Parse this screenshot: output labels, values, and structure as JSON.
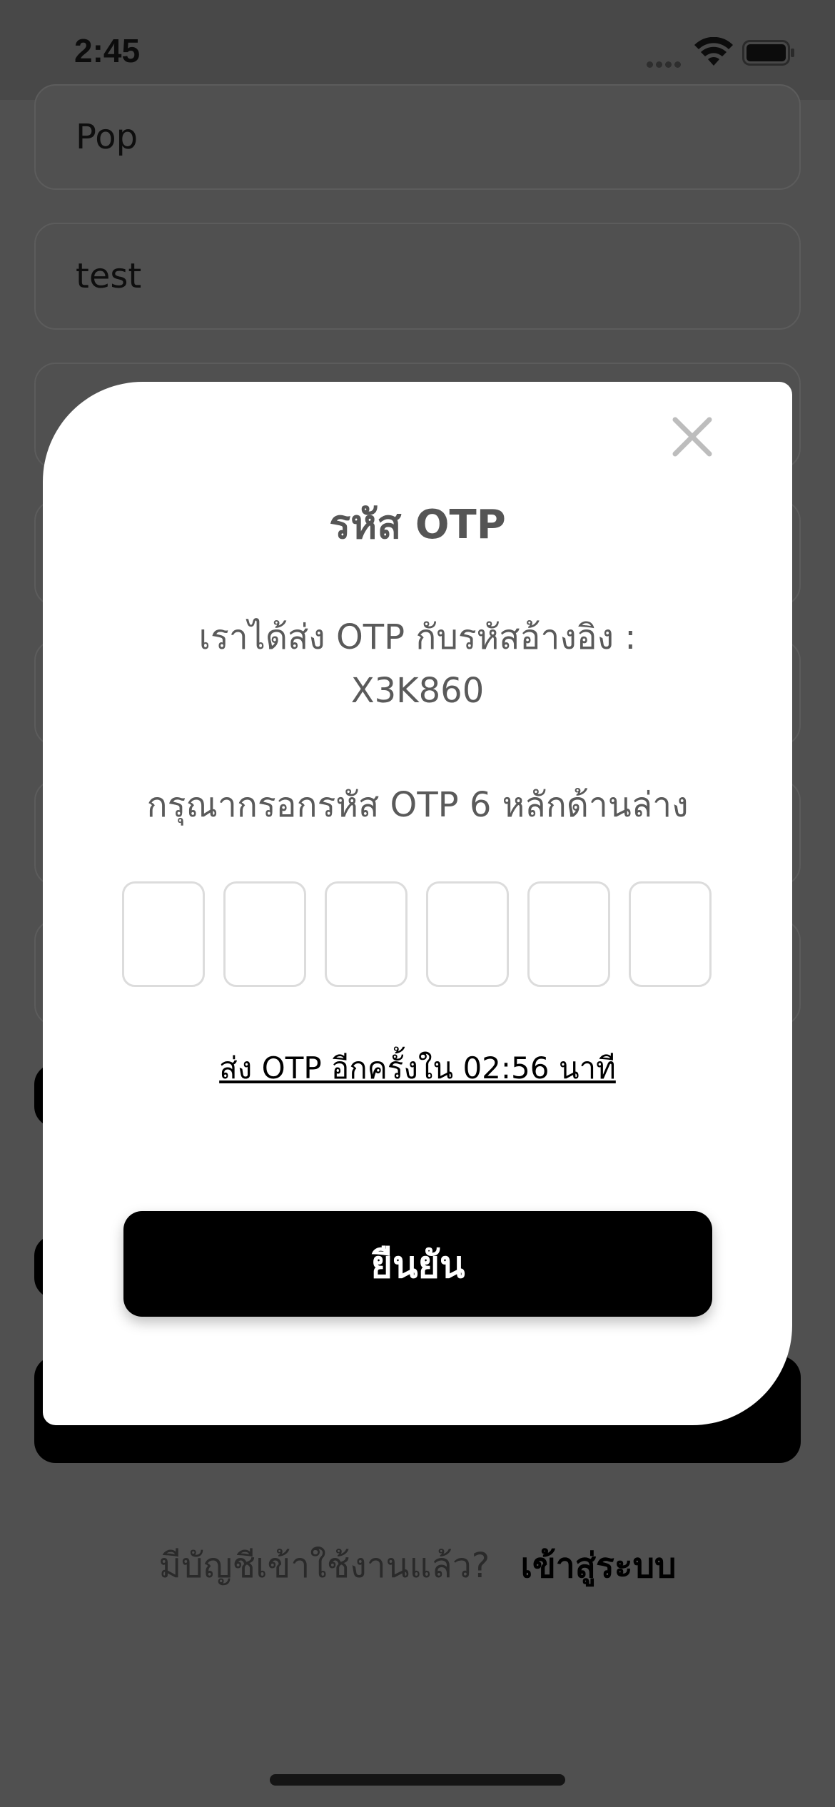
{
  "status_bar": {
    "time": "2:45",
    "icons": [
      "cellular-signal-icon",
      "wifi-icon",
      "battery-icon"
    ]
  },
  "background_form": {
    "fields": [
      {
        "value": "Pop"
      },
      {
        "value": "test"
      },
      {
        "value": ""
      },
      {
        "value": ""
      },
      {
        "value": ""
      },
      {
        "value": ""
      },
      {
        "value": ""
      }
    ],
    "signin_prompt": "มีบัญชีเข้าใช้งานแล้ว?",
    "signin_link": "เข้าสู่ระบบ"
  },
  "otp_modal": {
    "close_icon": "close-icon",
    "title": "รหัส OTP",
    "sent_message": "เราได้ส่ง OTP กับรหัสอ้างอิง :",
    "reference_code": "X3K860",
    "instruction": "กรุณากรอกรหัส OTP 6 หลักด้านล่าง",
    "otp_digits": [
      "",
      "",
      "",
      "",
      "",
      ""
    ],
    "resend_text": "ส่ง OTP อีกครั้งใน 02:56 นาที",
    "confirm_label": "ยืนยัน"
  },
  "colors": {
    "overlay_background": "#505050",
    "modal_background": "#ffffff",
    "primary_button": "#000000",
    "text_muted": "#5a5a5a"
  }
}
